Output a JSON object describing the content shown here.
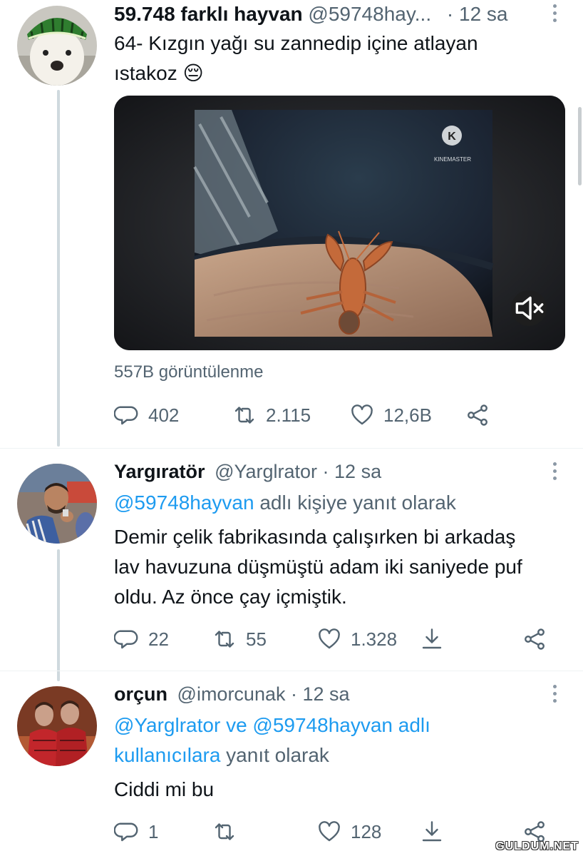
{
  "tweets": [
    {
      "display_name": "59.748 farklı hayvan",
      "handle": "@59748hay...",
      "time": "· 12 sa",
      "text_line1": "64- Kızgın yağı su zannedip içine atlayan",
      "text_line2": "ıstakoz 😔",
      "media_watermark": "KINEMASTER",
      "views": "557B görüntülenme",
      "replies": "402",
      "retweets": "2.115",
      "likes": "12,6B"
    },
    {
      "display_name": "Yargıratör",
      "handle": "@Yarglrator",
      "time": "· 12 sa",
      "reply_link": "@59748hayvan",
      "reply_suffix": " adlı kişiye yanıt olarak",
      "text_line1": "Demir çelik fabrikasında çalışırken bi arkadaş",
      "text_line2": "lav havuzuna düşmüştü adam iki saniyede puf",
      "text_line3": "oldu. Az önce çay içmiştik.",
      "replies": "22",
      "retweets": "55",
      "likes": "1.328"
    },
    {
      "display_name": "orçun",
      "handle": "@imorcunak",
      "time": "· 12 sa",
      "reply_line1": "@Yarglrator ve @59748hayvan adlı",
      "reply_line2_link": "kullanıcılara",
      "reply_line2_suffix": " yanıt olarak",
      "text_line1": "Ciddi mi bu",
      "replies": "1",
      "retweets": "",
      "likes": "128"
    }
  ],
  "watermark": "GULDUM.NET",
  "icons": {
    "reply": "speech-bubble-icon",
    "retweet": "retweet-icon",
    "like": "heart-icon",
    "share": "share-icon",
    "bookmark": "download-arrow-icon",
    "more": "more-vertical-icon",
    "mute": "speaker-muted-icon"
  },
  "colors": {
    "link": "#1d9bf0",
    "secondary": "#536471",
    "primary": "#0f1419"
  }
}
